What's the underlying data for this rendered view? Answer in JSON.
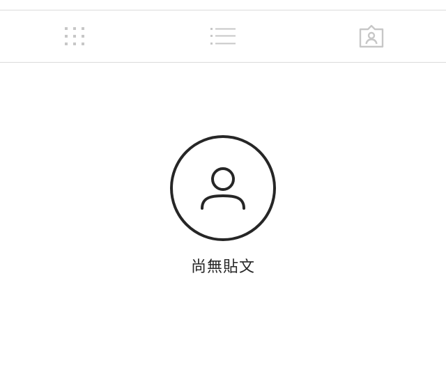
{
  "tabs": [
    {
      "name": "grid",
      "icon": "grid-icon"
    },
    {
      "name": "feed",
      "icon": "list-icon"
    },
    {
      "name": "tagged",
      "icon": "tagged-user-icon"
    }
  ],
  "empty_state": {
    "icon": "user-circle-icon",
    "title": "尚無貼文"
  },
  "colors": {
    "divider": "#dbdbdb",
    "inactive_icon": "#c7c7c7",
    "text": "#262626"
  }
}
